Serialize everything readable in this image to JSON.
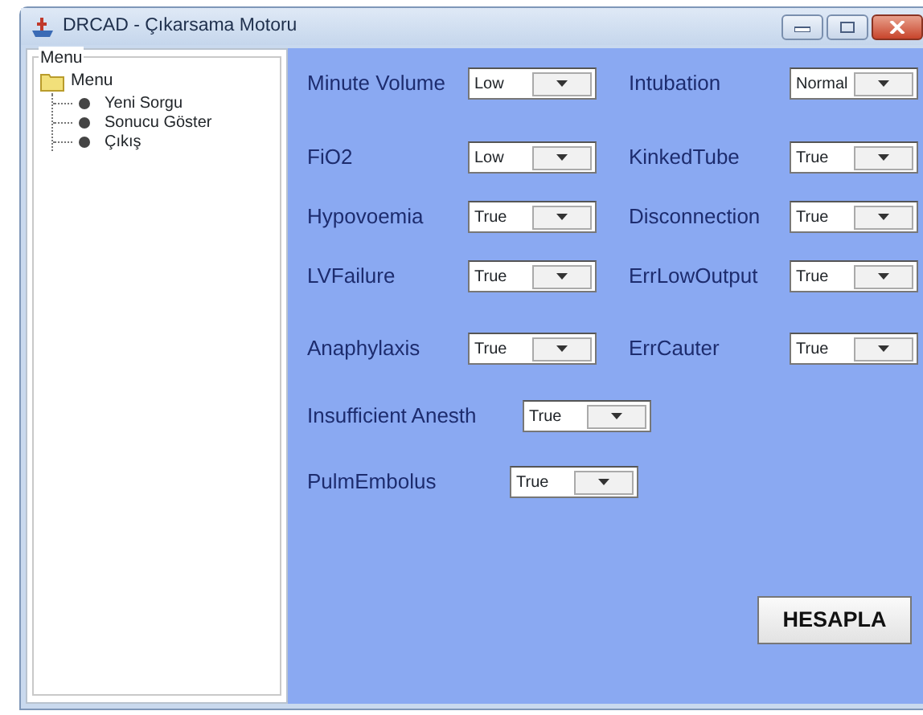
{
  "window": {
    "title": "DRCAD - Çıkarsama Motoru"
  },
  "menu_group": {
    "label": "Menu",
    "root": {
      "label": "Menu",
      "children": [
        {
          "label": "Yeni Sorgu"
        },
        {
          "label": "Sonucu Göster"
        },
        {
          "label": "Çıkış"
        }
      ]
    }
  },
  "form_rows": [
    {
      "fields": [
        {
          "label": "Minute Volume",
          "value": "Low"
        },
        {
          "label": "Intubation",
          "value": "Normal"
        }
      ]
    },
    {
      "fields": [
        {
          "label": "FiO2",
          "value": "Low"
        },
        {
          "label": "KinkedTube",
          "value": "True"
        }
      ]
    },
    {
      "fields": [
        {
          "label": "Hypovoemia",
          "value": "True"
        },
        {
          "label": "Disconnection",
          "value": "True"
        }
      ]
    },
    {
      "fields": [
        {
          "label": "LVFailure",
          "value": "True"
        },
        {
          "label": "ErrLowOutput",
          "value": "True"
        }
      ]
    },
    {
      "fields": [
        {
          "label": "Anaphylaxis",
          "value": "True"
        },
        {
          "label": "ErrCauter",
          "value": "True"
        }
      ]
    },
    {
      "fields": [
        {
          "label": "Insufficient Anesth",
          "value": "True"
        }
      ]
    },
    {
      "fields": [
        {
          "label": "PulmEmbolus",
          "value": "True"
        }
      ]
    }
  ],
  "action_button": "HESAPLA"
}
